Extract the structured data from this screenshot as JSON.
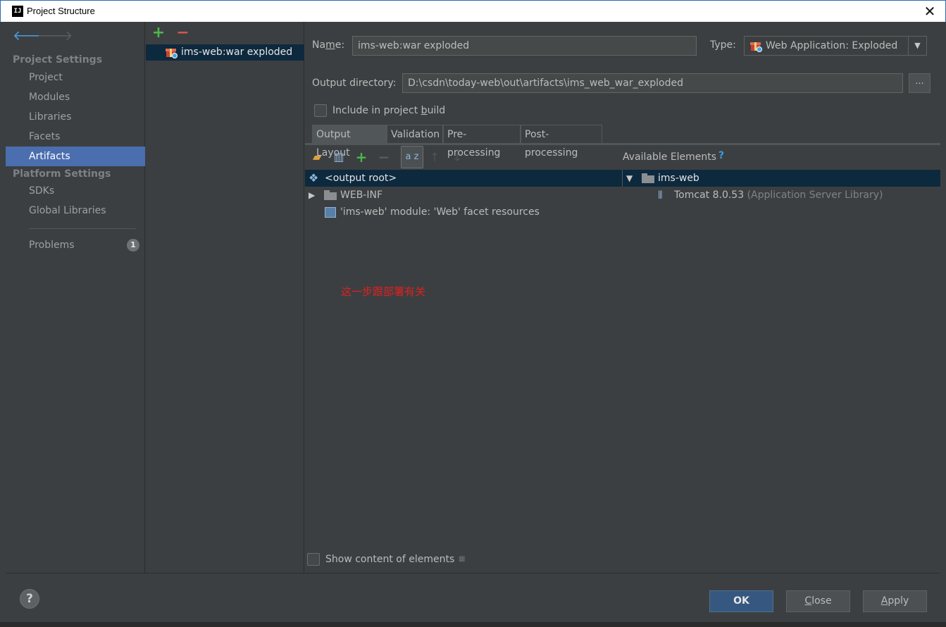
{
  "window": {
    "title": "Project Structure",
    "app_logo": "IJ",
    "close_symbol": "✕"
  },
  "nav": {
    "back_icon": "arrow-left-icon",
    "forward_icon": "arrow-right-icon",
    "project_settings_header": "Project Settings",
    "project_settings_items": [
      "Project",
      "Modules",
      "Libraries",
      "Facets",
      "Artifacts"
    ],
    "active_item": "Artifacts",
    "platform_settings_header": "Platform Settings",
    "platform_settings_items": [
      "SDKs",
      "Global Libraries"
    ],
    "problems_label": "Problems",
    "problems_count": "1"
  },
  "artifacts": {
    "add_symbol": "+",
    "remove_symbol": "−",
    "items": [
      "ims-web:war exploded"
    ]
  },
  "form": {
    "name_label_prefix": "Na",
    "name_label_mnemonic": "m",
    "name_label_suffix": "e:",
    "name_value": "ims-web:war exploded",
    "type_label": "Type:",
    "type_value": "Web Application: Exploded",
    "output_dir_label": "Output directory:",
    "output_dir_value": "D:\\csdn\\today-web\\out\\artifacts\\ims_web_war_exploded",
    "browse_label": "...",
    "include_in_build_prefix": "Include in project ",
    "include_in_build_mnemonic": "b",
    "include_in_build_suffix": "uild",
    "include_in_build_checked": false
  },
  "tabs": [
    "Output Layout",
    "Validation",
    "Pre-processing",
    "Post-processing"
  ],
  "active_tab": "Output Layout",
  "layout": {
    "sort_label": "a z",
    "available_elements_label": "Available Elements",
    "help_symbol": "?",
    "tree": [
      {
        "label": "<output root>",
        "selected": true
      },
      {
        "label": "WEB-INF",
        "expandable": true
      },
      {
        "label": "'ims-web' module: 'Web' facet resources"
      }
    ],
    "available_tree": {
      "root": "ims-web",
      "child_name": "Tomcat 8.0.53",
      "child_hint": "(Application Server Library)"
    },
    "annotation": "这一步跟部署有关",
    "show_content_label": "Show content of elements",
    "show_content_checked": false
  },
  "footer": {
    "help_symbol": "?",
    "ok_label": "OK",
    "close_label_mnemonic": "C",
    "close_label_rest": "lose",
    "apply_label_mnemonic": "A",
    "apply_label_rest": "pply"
  },
  "colors": {
    "background": "#3c3f41",
    "selection": "#4b6eaf",
    "tree_selection": "#0d293e",
    "primary_button": "#365880",
    "annotation": "#e02020"
  }
}
